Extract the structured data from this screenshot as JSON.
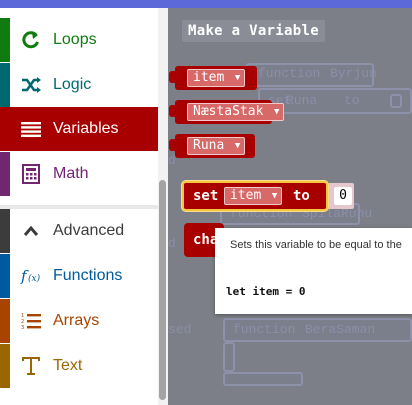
{
  "toolbox": {
    "categories": [
      {
        "label": "Loops",
        "icon": "loop-arrow-icon",
        "color": "#107c10",
        "selected": false
      },
      {
        "label": "Logic",
        "icon": "shuffle-icon",
        "color": "#006970",
        "selected": false
      },
      {
        "label": "Variables",
        "icon": "list-lines-icon",
        "color": "#a80000",
        "selected": true
      },
      {
        "label": "Math",
        "icon": "calculator-icon",
        "color": "#712672",
        "selected": false
      },
      {
        "label": "Advanced",
        "icon": "chevron-up-icon",
        "color": "#3c3c3c",
        "selected": false
      },
      {
        "label": "Functions",
        "icon": "fx-icon",
        "color": "#005a9e",
        "selected": false
      },
      {
        "label": "Arrays",
        "icon": "numbered-list-icon",
        "color": "#a94400",
        "selected": false
      },
      {
        "label": "Text",
        "icon": "text-t-icon",
        "color": "#996600",
        "selected": false
      }
    ]
  },
  "flyout": {
    "make_variable_label": "Make a Variable",
    "variables": [
      "item",
      "NæstaStak",
      "Runa"
    ],
    "set_block": {
      "keyword_set": "set",
      "variable": "item",
      "keyword_to": "to",
      "value": "0"
    },
    "change_block_partial": "cha"
  },
  "tooltip": {
    "description": "Sets this variable to be equal to the",
    "code": "let item = 0"
  },
  "background_ghosts": {
    "function_1": "function",
    "function_1_name": "Byrjun",
    "set_fragment": "set",
    "runa_fragment": "Runa",
    "to_fragment": "to",
    "function_2": "function",
    "function_2_name": "SpilaRunu",
    "function_3": "function",
    "function_3_name": "BeraSaman",
    "d_fragment_1": "d",
    "d_fragment_2": "d",
    "sed_fragment": "sed"
  },
  "colors": {
    "variables_accent": "#a80000",
    "selection_outline": "#f5c542",
    "flyout_bg": "#7c7f87"
  }
}
